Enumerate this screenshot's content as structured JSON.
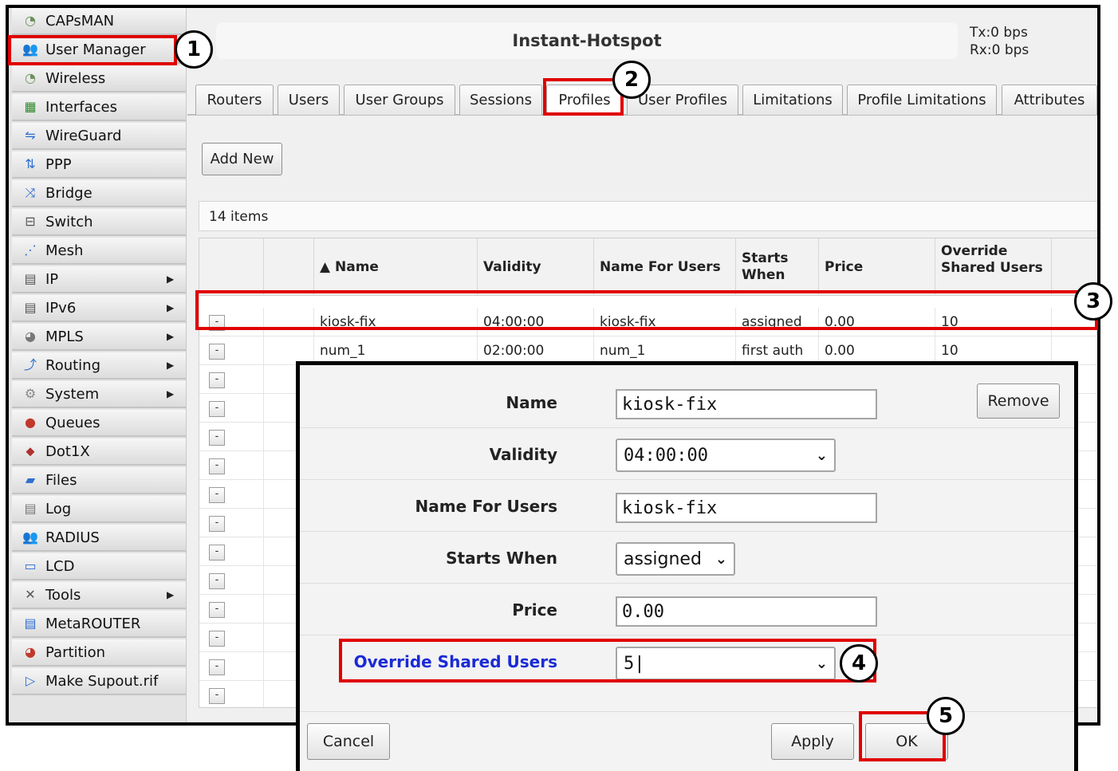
{
  "sidebar": {
    "items": [
      {
        "label": "CAPsMAN",
        "icon": "capsman-icon",
        "glyph": "◔",
        "color": "#6a8f5c",
        "arrow": ""
      },
      {
        "label": "User Manager",
        "icon": "user-manager-icon",
        "glyph": "👥",
        "color": "#2e6fcf",
        "arrow": ""
      },
      {
        "label": "Wireless",
        "icon": "wireless-icon",
        "glyph": "◔",
        "color": "#6a8f5c",
        "arrow": ""
      },
      {
        "label": "Interfaces",
        "icon": "interfaces-icon",
        "glyph": "▦",
        "color": "#2f8a2f",
        "arrow": ""
      },
      {
        "label": "WireGuard",
        "icon": "wireguard-icon",
        "glyph": "⇋",
        "color": "#2e6fcf",
        "arrow": ""
      },
      {
        "label": "PPP",
        "icon": "ppp-icon",
        "glyph": "⇅",
        "color": "#2e6fcf",
        "arrow": ""
      },
      {
        "label": "Bridge",
        "icon": "bridge-icon",
        "glyph": "⤨",
        "color": "#2e6fcf",
        "arrow": ""
      },
      {
        "label": "Switch",
        "icon": "switch-icon",
        "glyph": "⊟",
        "color": "#555555",
        "arrow": ""
      },
      {
        "label": "Mesh",
        "icon": "mesh-icon",
        "glyph": "⋰",
        "color": "#2e6fcf",
        "arrow": ""
      },
      {
        "label": "IP",
        "icon": "ip-icon",
        "glyph": "▤",
        "color": "#555555",
        "arrow": "▶"
      },
      {
        "label": "IPv6",
        "icon": "ipv6-icon",
        "glyph": "▤",
        "color": "#555555",
        "arrow": "▶"
      },
      {
        "label": "MPLS",
        "icon": "mpls-icon",
        "glyph": "◕",
        "color": "#777777",
        "arrow": "▶"
      },
      {
        "label": "Routing",
        "icon": "routing-icon",
        "glyph": "⤴",
        "color": "#2e6fcf",
        "arrow": "▶"
      },
      {
        "label": "System",
        "icon": "system-icon",
        "glyph": "⚙",
        "color": "#888888",
        "arrow": "▶"
      },
      {
        "label": "Queues",
        "icon": "queues-icon",
        "glyph": "●",
        "color": "#c0392b",
        "arrow": ""
      },
      {
        "label": "Dot1X",
        "icon": "dot1x-icon",
        "glyph": "⬥",
        "color": "#b03030",
        "arrow": ""
      },
      {
        "label": "Files",
        "icon": "files-icon",
        "glyph": "▰",
        "color": "#2e6fcf",
        "arrow": ""
      },
      {
        "label": "Log",
        "icon": "log-icon",
        "glyph": "▤",
        "color": "#777777",
        "arrow": ""
      },
      {
        "label": "RADIUS",
        "icon": "radius-icon",
        "glyph": "👥",
        "color": "#d08a1a",
        "arrow": ""
      },
      {
        "label": "LCD",
        "icon": "lcd-icon",
        "glyph": "▭",
        "color": "#2e6fcf",
        "arrow": ""
      },
      {
        "label": "Tools",
        "icon": "tools-icon",
        "glyph": "✕",
        "color": "#555555",
        "arrow": "▶"
      },
      {
        "label": "MetaROUTER",
        "icon": "metarouter-icon",
        "glyph": "▤",
        "color": "#2e6fcf",
        "arrow": ""
      },
      {
        "label": "Partition",
        "icon": "partition-icon",
        "glyph": "◕",
        "color": "#c0392b",
        "arrow": ""
      },
      {
        "label": "Make Supout.rif",
        "icon": "supout-icon",
        "glyph": "▷",
        "color": "#2e6fcf",
        "arrow": ""
      }
    ]
  },
  "header": {
    "title": "Instant-Hotspot",
    "tx": "Tx:0 bps",
    "rx": "Rx:0 bps"
  },
  "tabs": [
    {
      "label": "Routers"
    },
    {
      "label": "Users"
    },
    {
      "label": "User Groups"
    },
    {
      "label": "Sessions"
    },
    {
      "label": "Profiles"
    },
    {
      "label": "User Profiles"
    },
    {
      "label": "Limitations"
    },
    {
      "label": "Profile Limitations"
    },
    {
      "label": "Attributes"
    }
  ],
  "toolbar": {
    "add_new_label": "Add New"
  },
  "list": {
    "count_text": "14 items"
  },
  "table": {
    "columns": {
      "name": "▲ Name",
      "validity": "Validity",
      "name_for_users": "Name For Users",
      "starts_when": "Starts When",
      "price": "Price",
      "override_shared_users": "Override Shared Users"
    },
    "row_button_label": "-",
    "rows": [
      {
        "name": "kiosk-fix",
        "validity": "04:00:00",
        "name_for_users": "kiosk-fix",
        "starts_when": "assigned",
        "price": "0.00",
        "override_shared_users": "10"
      },
      {
        "name": "num_1",
        "validity": "02:00:00",
        "name_for_users": "num_1",
        "starts_when": "first auth",
        "price": "0.00",
        "override_shared_users": "10"
      }
    ]
  },
  "dialog": {
    "remove_label": "Remove",
    "fields": {
      "name_label": "Name",
      "name_value": "kiosk-fix",
      "validity_label": "Validity",
      "validity_value": "04:00:00",
      "name_for_users_label": "Name For Users",
      "name_for_users_value": "kiosk-fix",
      "starts_when_label": "Starts When",
      "starts_when_value": "assigned",
      "price_label": "Price",
      "price_value": "0.00",
      "override_shared_users_label": "Override Shared Users",
      "override_shared_users_value": "5|"
    },
    "buttons": {
      "cancel": "Cancel",
      "apply": "Apply",
      "ok": "OK"
    }
  },
  "annotations": {
    "step1": "1",
    "step2": "2",
    "step3": "3",
    "step4": "4",
    "step5": "5",
    "highlight_color": "#e00000",
    "link_color": "#1a2bd6"
  }
}
